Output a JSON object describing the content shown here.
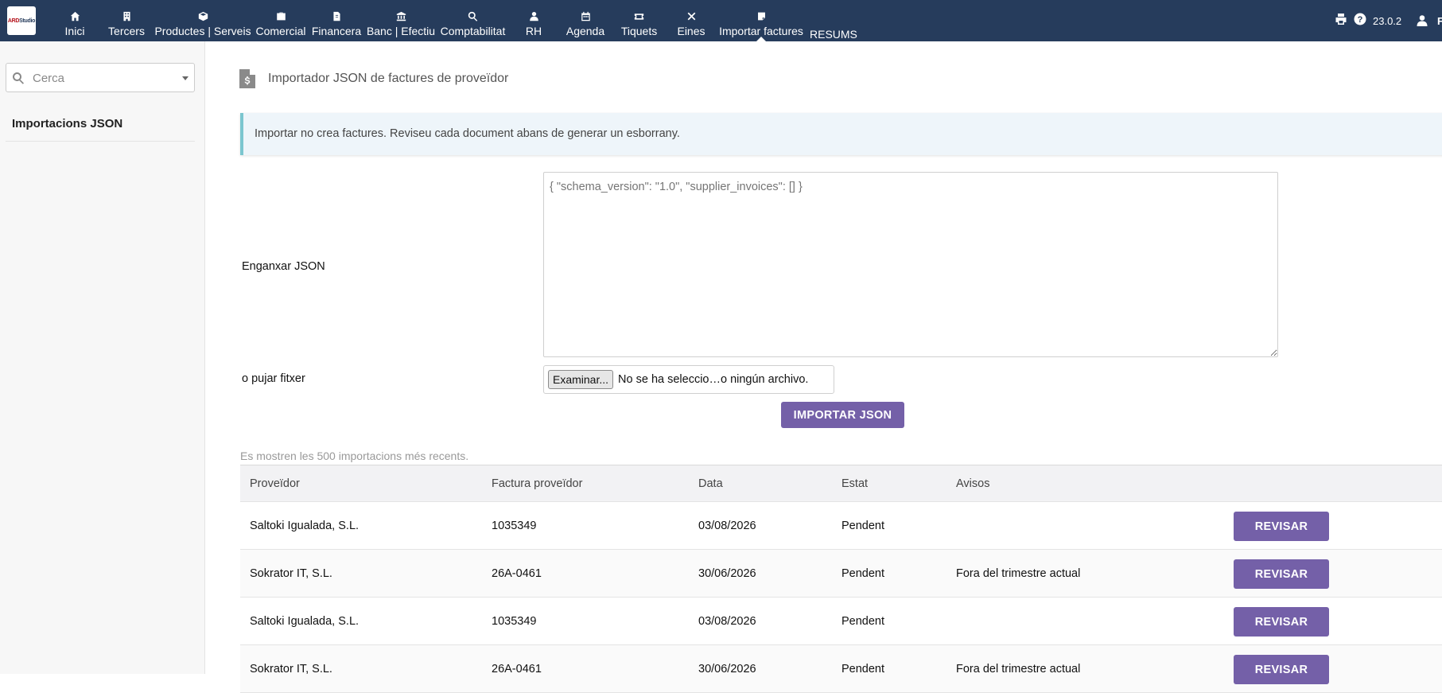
{
  "app": {
    "logo_text": "ARDStudio",
    "version": "23.0.2",
    "user_initial": "F"
  },
  "nav": {
    "items": [
      {
        "label": "Inici",
        "icon": "home-icon"
      },
      {
        "label": "Tercers",
        "icon": "building-icon"
      },
      {
        "label": "Productes | Serveis",
        "icon": "cube-icon"
      },
      {
        "label": "Comercial",
        "icon": "briefcase-icon"
      },
      {
        "label": "Financera",
        "icon": "invoice-icon"
      },
      {
        "label": "Banc | Efectiu",
        "icon": "bank-icon"
      },
      {
        "label": "Comptabilitat",
        "icon": "search-dollar-icon"
      },
      {
        "label": "RH",
        "icon": "user-icon"
      },
      {
        "label": "Agenda",
        "icon": "calendar-icon"
      },
      {
        "label": "Tiquets",
        "icon": "ticket-icon"
      },
      {
        "label": "Eines",
        "icon": "tools-icon"
      },
      {
        "label": "Importar factures",
        "icon": "note-icon"
      }
    ],
    "extra": "RESUMS",
    "active": "Importar factures"
  },
  "sidebar": {
    "search_placeholder": "Cerca",
    "items": [
      {
        "label": "Importacions JSON"
      }
    ]
  },
  "main": {
    "title": "Importador JSON de factures de proveïdor",
    "info": "Importar no crea factures. Reviseu cada document abans de generar un esborrany.",
    "paste_label": "Enganxar JSON",
    "json_placeholder": "{ \"schema_version\": \"1.0\", \"supplier_invoices\": [] }",
    "upload_label": "o pujar fitxer",
    "file_button": "Examinar...",
    "file_status": "No se ha seleccio…o ningún archivo.",
    "import_button": "IMPORTAR JSON",
    "recent_note": "Es mostren les 500 importacions més recents."
  },
  "table": {
    "headers": [
      "Proveïdor",
      "Factura proveïdor",
      "Data",
      "Estat",
      "Avisos"
    ],
    "action_label": "REVISAR",
    "rows": [
      {
        "supplier": "Saltoki Igualada, S.L.",
        "invoice": "1035349",
        "date": "03/08/2026",
        "status": "Pendent",
        "warnings": ""
      },
      {
        "supplier": "Sokrator IT, S.L.",
        "invoice": "26A-0461",
        "date": "30/06/2026",
        "status": "Pendent",
        "warnings": "Fora del trimestre actual"
      },
      {
        "supplier": "Saltoki Igualada, S.L.",
        "invoice": "1035349",
        "date": "03/08/2026",
        "status": "Pendent",
        "warnings": ""
      },
      {
        "supplier": "Sokrator IT, S.L.",
        "invoice": "26A-0461",
        "date": "30/06/2026",
        "status": "Pendent",
        "warnings": "Fora del trimestre actual"
      }
    ]
  },
  "colors": {
    "topbar": "#263c5c",
    "accent_button": "#7460a8",
    "info_border": "#7bc6cf"
  }
}
